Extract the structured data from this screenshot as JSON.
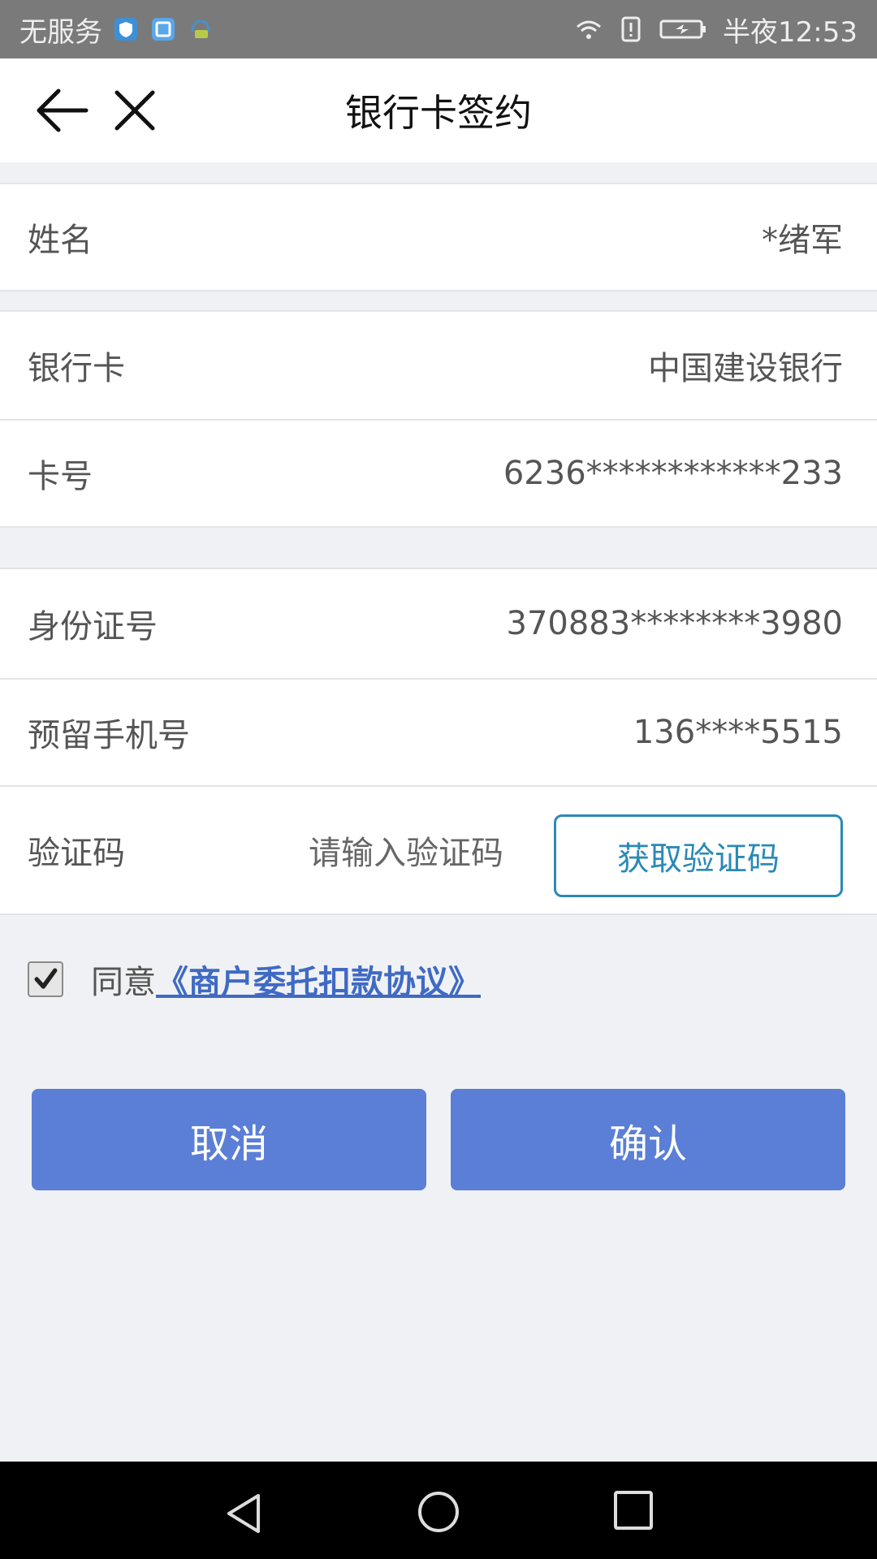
{
  "status_bar": {
    "carrier": "无服务",
    "time": "半夜12:53",
    "icons": [
      "shield-icon",
      "loan-app-icon",
      "headset-icon",
      "wifi-icon",
      "alert-icon",
      "battery-charging-icon"
    ]
  },
  "nav": {
    "title": "银行卡签约",
    "back_icon": "back-arrow-icon",
    "close_icon": "close-icon"
  },
  "form": {
    "name": {
      "label": "姓名",
      "value": "*绪军"
    },
    "bank": {
      "label": "银行卡",
      "value": "中国建设银行"
    },
    "card_number": {
      "label": "卡号",
      "value": "6236************233"
    },
    "id_number": {
      "label": "身份证号",
      "value": "370883********3980"
    },
    "phone": {
      "label": "预留手机号",
      "value": "136****5515"
    },
    "code": {
      "label": "验证码",
      "placeholder": "请输入验证码",
      "button_label": "获取验证码"
    }
  },
  "agreement": {
    "checked": true,
    "prefix": "同意",
    "link_text": "《商户委托扣款协议》"
  },
  "buttons": {
    "cancel_label": "取消",
    "confirm_label": "确认"
  },
  "colors": {
    "primary_button": "#5b7fd6",
    "link": "#3f6ac4",
    "code_button": "#2a8ab6",
    "background": "#f0f1f4"
  }
}
